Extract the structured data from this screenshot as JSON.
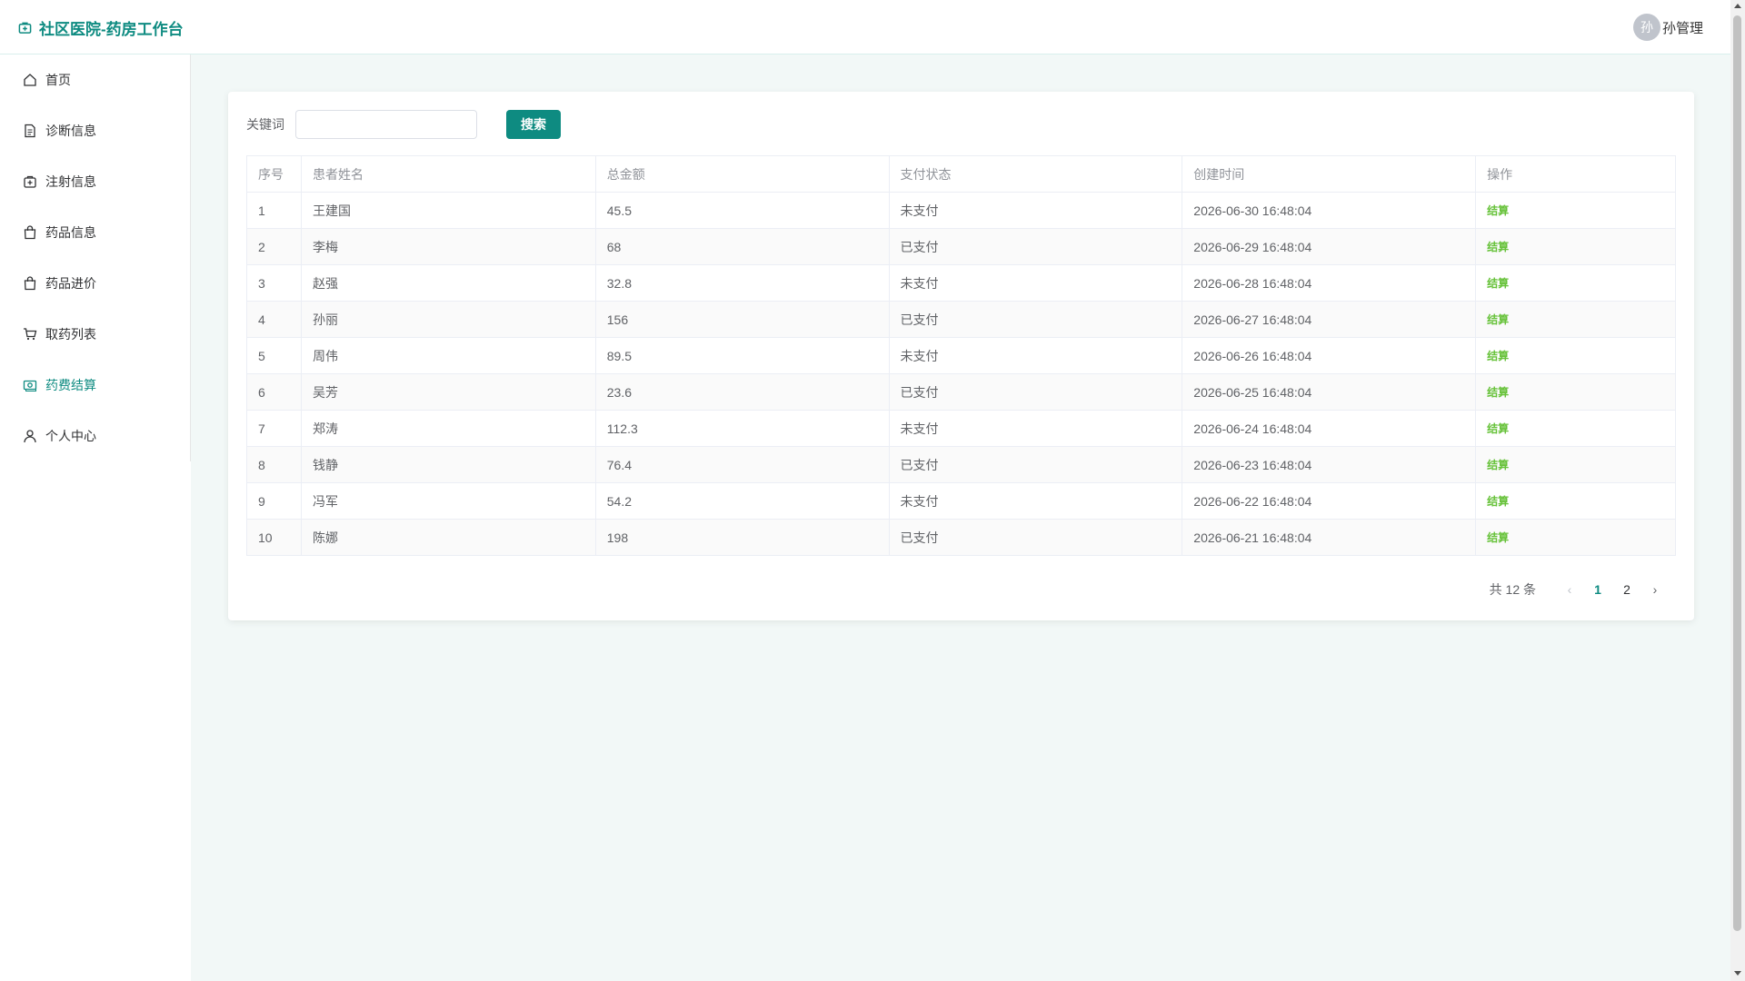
{
  "header": {
    "title": "社区医院-药房工作台",
    "avatar_text": "孙",
    "user_name": "孙管理"
  },
  "sidebar": {
    "items": [
      {
        "label": "首页",
        "icon": "home-icon"
      },
      {
        "label": "诊断信息",
        "icon": "document-icon"
      },
      {
        "label": "注射信息",
        "icon": "first-aid-icon"
      },
      {
        "label": "药品信息",
        "icon": "bag-icon"
      },
      {
        "label": "药品进价",
        "icon": "bag-icon"
      },
      {
        "label": "取药列表",
        "icon": "cart-icon"
      },
      {
        "label": "药费结算",
        "icon": "money-icon",
        "active": true
      },
      {
        "label": "个人中心",
        "icon": "user-icon"
      }
    ]
  },
  "search": {
    "label": "关键词",
    "value": "",
    "placeholder": "",
    "button_label": "搜索"
  },
  "table": {
    "headers": [
      "序号",
      "患者姓名",
      "总金额",
      "支付状态",
      "创建时间",
      "操作"
    ],
    "rows": [
      [
        "1",
        "王建国",
        "45.5",
        "未支付",
        "2026-06-30 16:48:04",
        "结算"
      ],
      [
        "2",
        "李梅",
        "68",
        "已支付",
        "2026-06-29 16:48:04",
        "结算"
      ],
      [
        "3",
        "赵强",
        "32.8",
        "未支付",
        "2026-06-28 16:48:04",
        "结算"
      ],
      [
        "4",
        "孙丽",
        "156",
        "已支付",
        "2026-06-27 16:48:04",
        "结算"
      ],
      [
        "5",
        "周伟",
        "89.5",
        "未支付",
        "2026-06-26 16:48:04",
        "结算"
      ],
      [
        "6",
        "吴芳",
        "23.6",
        "已支付",
        "2026-06-25 16:48:04",
        "结算"
      ],
      [
        "7",
        "郑涛",
        "112.3",
        "未支付",
        "2026-06-24 16:48:04",
        "结算"
      ],
      [
        "8",
        "钱静",
        "76.4",
        "已支付",
        "2026-06-23 16:48:04",
        "结算"
      ],
      [
        "9",
        "冯军",
        "54.2",
        "未支付",
        "2026-06-22 16:48:04",
        "结算"
      ],
      [
        "10",
        "陈娜",
        "198",
        "已支付",
        "2026-06-21 16:48:04",
        "结算"
      ]
    ]
  },
  "pagination": {
    "total_text": "共 12 条",
    "pages": [
      "1",
      "2"
    ],
    "current": "1"
  },
  "colors": {
    "primary": "#0e8b81",
    "link_green": "#67c23a",
    "main_bg": "#f2f8f7"
  }
}
